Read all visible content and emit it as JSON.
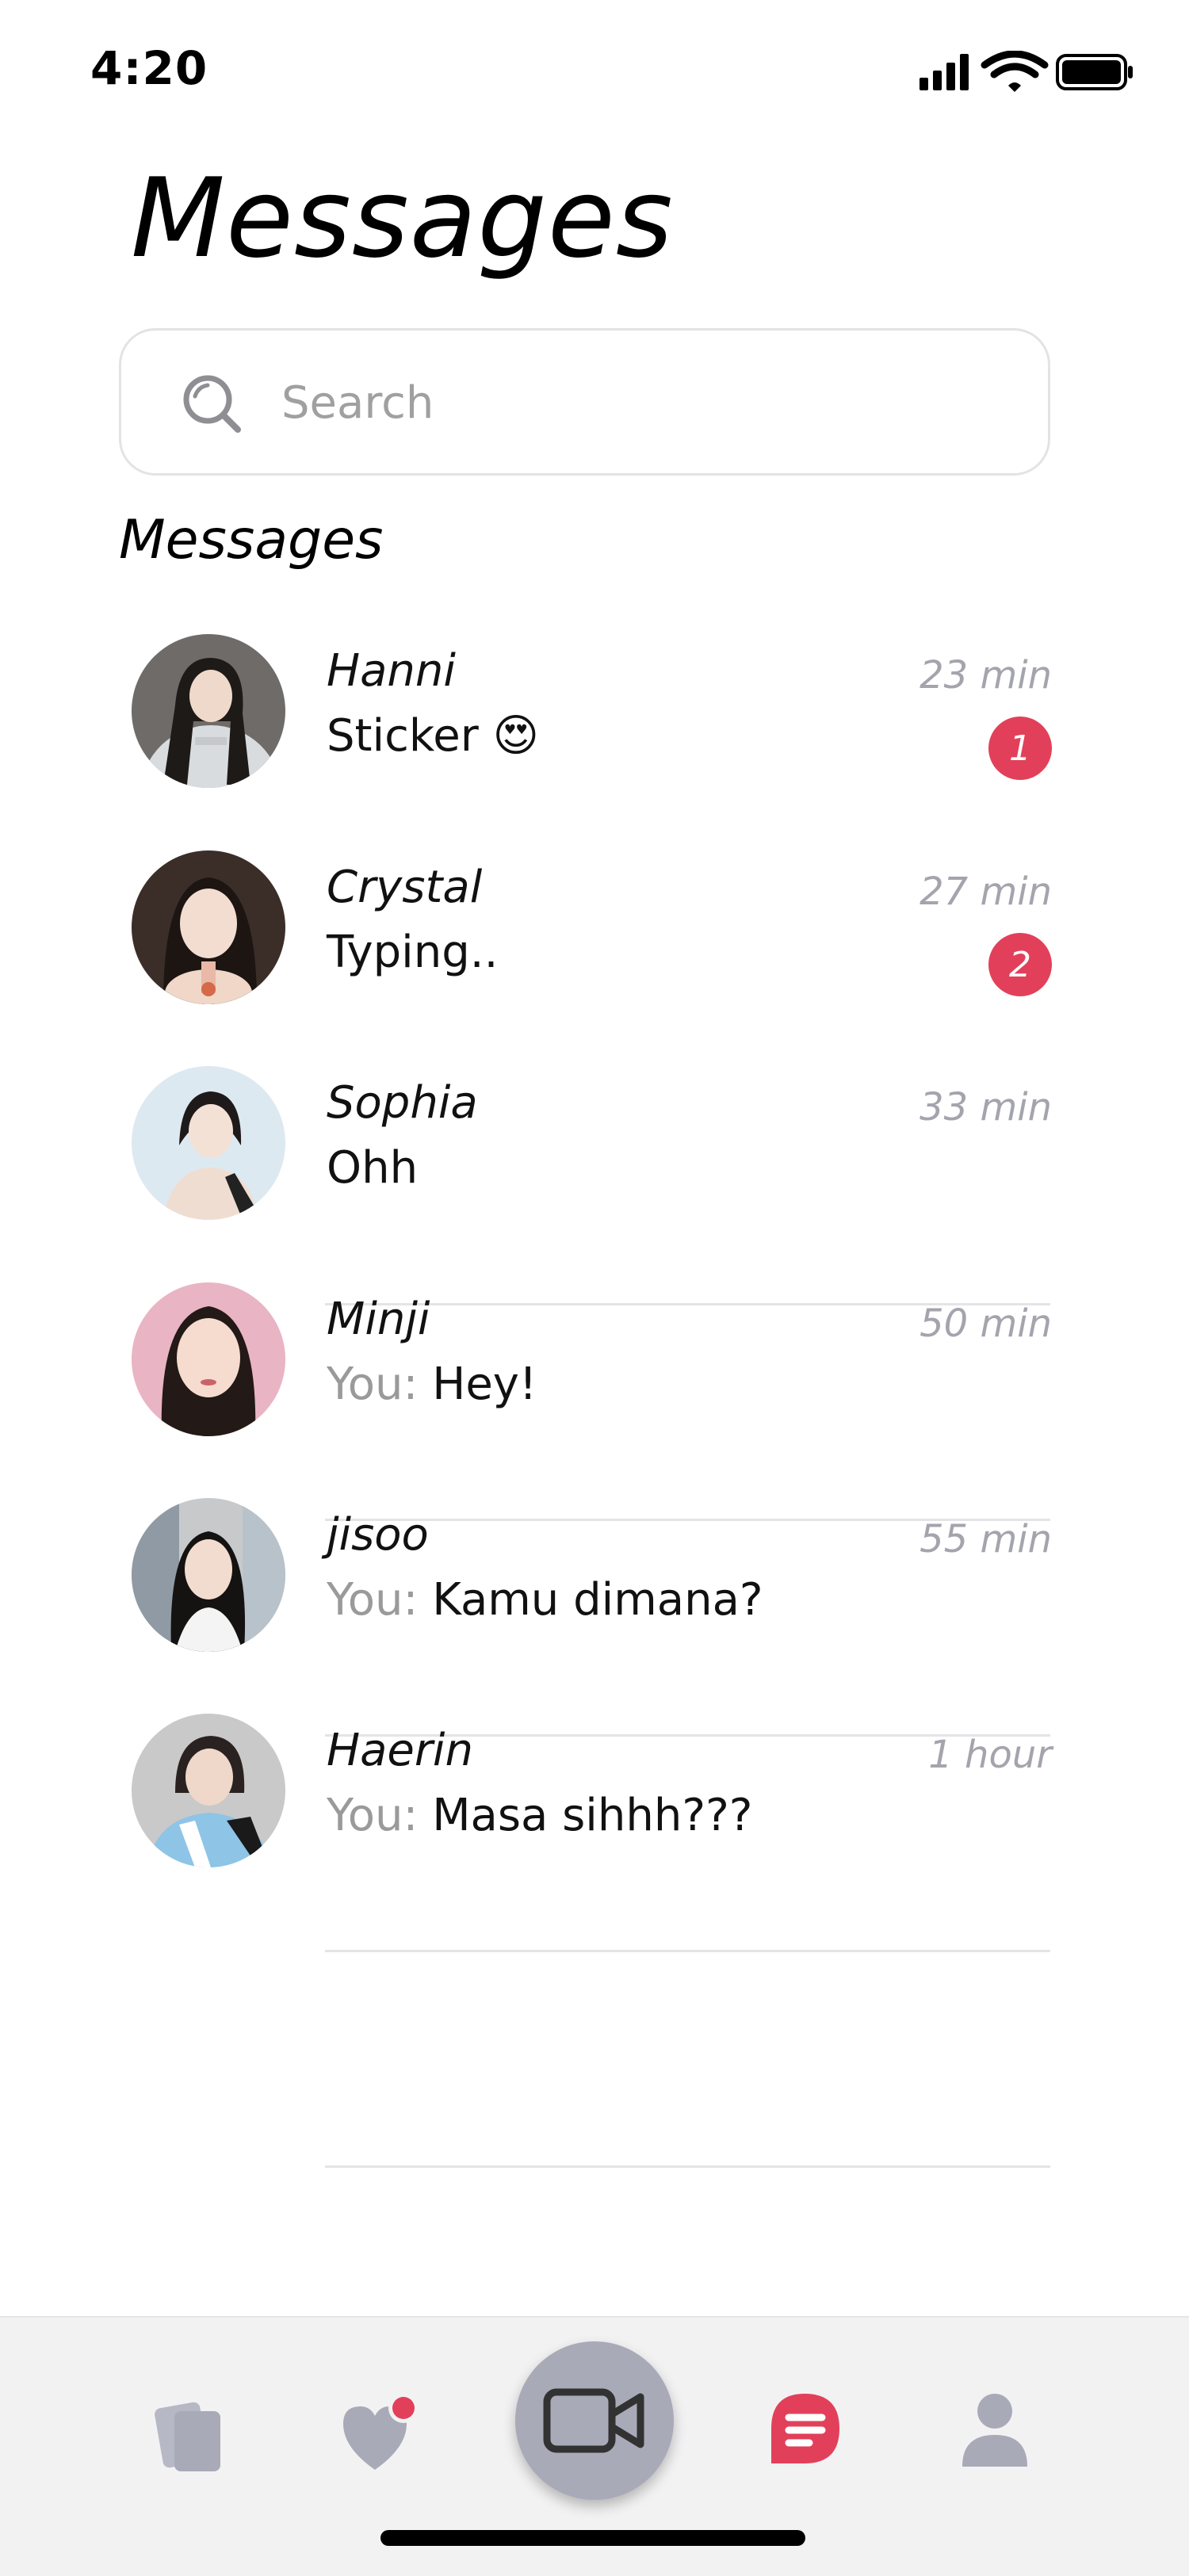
{
  "status_bar": {
    "time": "4:20"
  },
  "header": {
    "title": "Messages"
  },
  "search": {
    "placeholder": "Search"
  },
  "section": {
    "title": "Messages"
  },
  "conversations": [
    {
      "name": "Hanni",
      "time": "23 min",
      "preview": "Sticker 😍",
      "you_prefix": "",
      "unread": "1"
    },
    {
      "name": "Crystal",
      "time": "27 min",
      "preview": "Typing..",
      "you_prefix": "",
      "unread": "2"
    },
    {
      "name": "Sophia",
      "time": "33 min",
      "preview": "Ohh",
      "you_prefix": "",
      "unread": ""
    },
    {
      "name": "Minji",
      "time": "50 min",
      "preview": "Hey!",
      "you_prefix": "You: ",
      "unread": ""
    },
    {
      "name": "jisoo",
      "time": "55 min",
      "preview": "Kamu dimana?",
      "you_prefix": "You: ",
      "unread": ""
    },
    {
      "name": "Haerin",
      "time": "1 hour",
      "preview": "Masa sihhh???",
      "you_prefix": "You: ",
      "unread": ""
    }
  ],
  "tab_bar": {
    "items": [
      {
        "icon": "cards-icon"
      },
      {
        "icon": "heart-notification-icon"
      },
      {
        "icon": "video-camera-icon"
      },
      {
        "icon": "chat-icon"
      },
      {
        "icon": "profile-icon"
      }
    ]
  },
  "colors": {
    "accent": "#e2405a",
    "muted_text": "#a4a4ad",
    "tab_icon": "#a9aab8"
  }
}
